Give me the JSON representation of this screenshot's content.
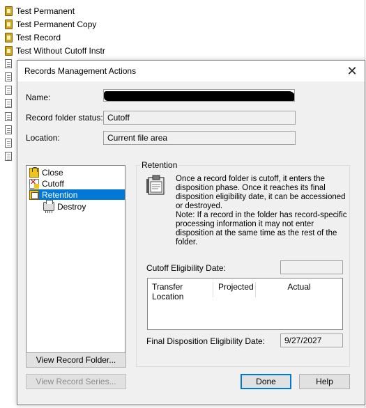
{
  "background": {
    "folders": [
      "Test Permanent",
      "Test Permanent Copy",
      "Test Record",
      "Test Without Cutoff Instr"
    ]
  },
  "dialog": {
    "title": "Records Management Actions",
    "name_label": "Name:",
    "status_label": "Record folder status:",
    "status_value": "Cutoff",
    "location_label": "Location:",
    "location_value": "Current file area",
    "tree": {
      "items": [
        {
          "label": "Close",
          "icon": "lock-folder-icon"
        },
        {
          "label": "Cutoff",
          "icon": "cutoff-icon"
        },
        {
          "label": "Retention",
          "icon": "retention-icon",
          "selected": true
        },
        {
          "label": "Destroy",
          "icon": "shredder-icon"
        }
      ]
    },
    "retention": {
      "group_label": "Retention",
      "description": "Once a record folder is cutoff, it enters the disposition phase. Once it reaches its final disposition eligibility date, it can be accessioned or destroyed.",
      "note": "Note: If a record in the folder has record-specific processing information it may not enter disposition at the same time as the rest of the folder.",
      "cutoff_label": "Cutoff Eligibility Date:",
      "cutoff_value": "",
      "table_headers": [
        "Transfer Location",
        "Projected",
        "Actual"
      ],
      "final_label": "Final Disposition Eligibility Date:",
      "final_value": "9/27/2027"
    },
    "buttons": {
      "view_folder": "View Record Folder...",
      "view_series": "View Record Series...",
      "done": "Done",
      "help": "Help"
    }
  }
}
